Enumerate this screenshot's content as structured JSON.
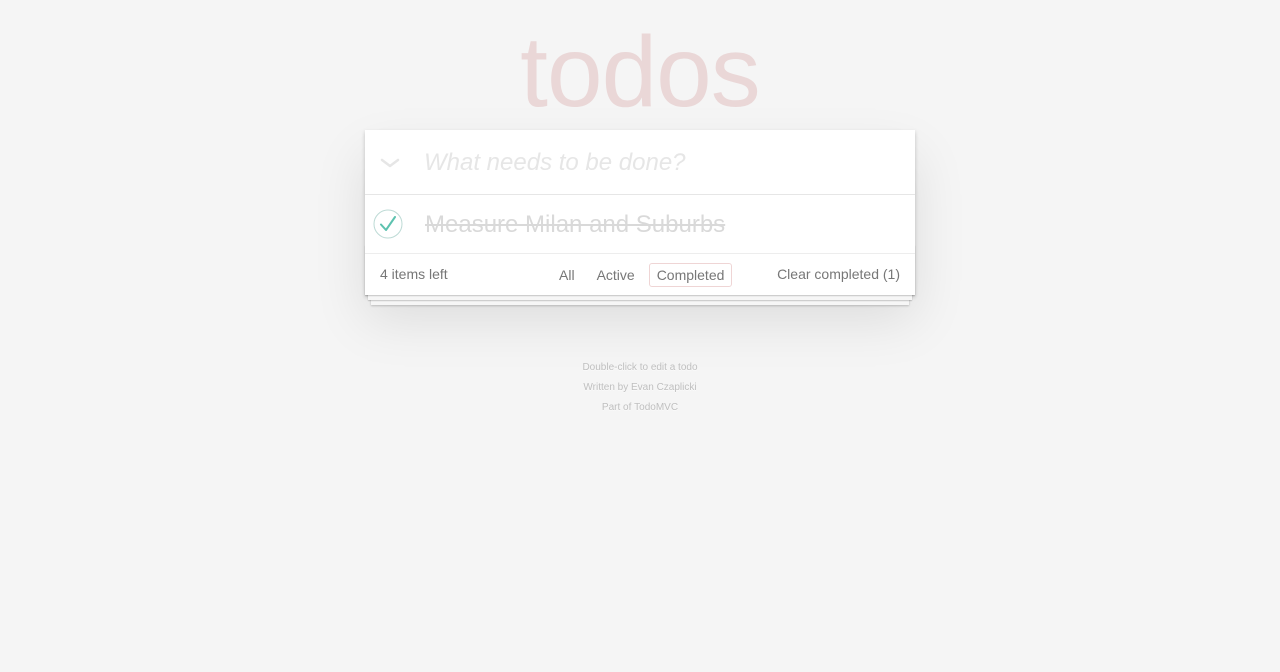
{
  "app": {
    "title": "todos"
  },
  "header": {
    "toggle_all_icon": "chevron-down-icon",
    "new_todo_placeholder": "What needs to be done?",
    "new_todo_value": ""
  },
  "todos": [
    {
      "label": "Measure Milan and Suburbs",
      "completed": true,
      "check_icon": "checkmark-icon"
    }
  ],
  "footer": {
    "count_text": "4 items left",
    "filters": [
      {
        "label": "All",
        "selected": false
      },
      {
        "label": "Active",
        "selected": false
      },
      {
        "label": "Completed",
        "selected": true
      }
    ],
    "clear_completed_label": "Clear completed (1)"
  },
  "info": {
    "hint": "Double-click to edit a todo",
    "written_by_prefix": "Written by ",
    "author": "Evan Czaplicki",
    "part_of_prefix": "Part of ",
    "project": "TodoMVC"
  },
  "colors": {
    "title": "#f0dcdc",
    "check": "#5dc2af",
    "selected_filter_border": "#efd5d5",
    "background": "#f5f5f5"
  }
}
